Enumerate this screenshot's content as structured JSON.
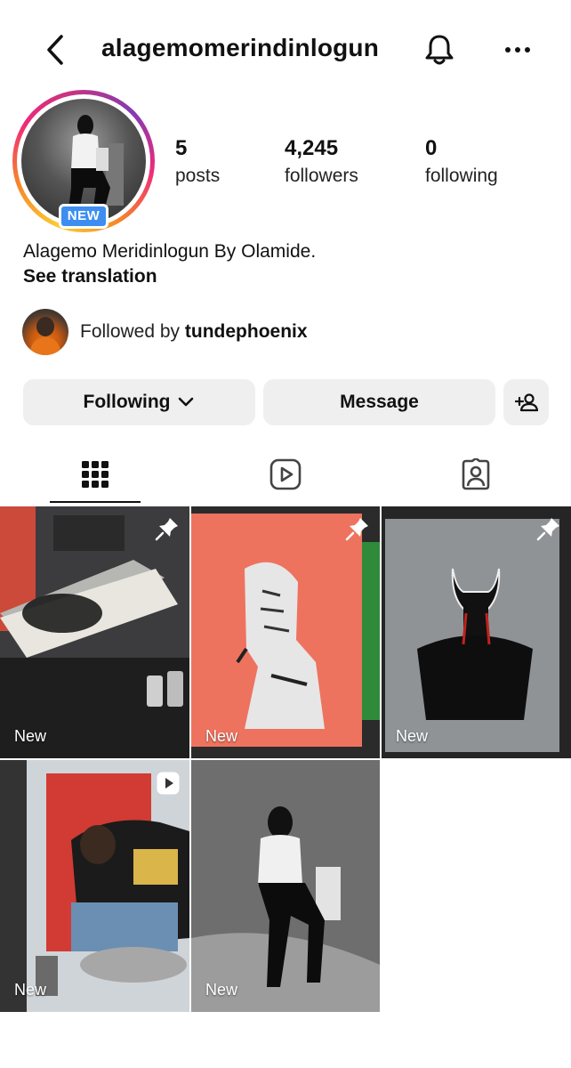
{
  "header": {
    "username": "alagemomerindinlogun"
  },
  "profile": {
    "badge": "NEW",
    "stats": [
      {
        "value": "5",
        "label": "posts"
      },
      {
        "value": "4,245",
        "label": "followers"
      },
      {
        "value": "0",
        "label": "following"
      }
    ],
    "bio": "Alagemo Meridinlogun By Olamide.",
    "see_translation": "See translation",
    "followed_by_prefix": "Followed by",
    "followed_by_user": "tundephoenix"
  },
  "actions": {
    "following": "Following",
    "message": "Message"
  },
  "grid": {
    "tiles": [
      {
        "label": "New",
        "badge": "pin"
      },
      {
        "label": "New",
        "badge": "pin"
      },
      {
        "label": "New",
        "badge": "pin"
      },
      {
        "label": "New",
        "badge": "reel"
      },
      {
        "label": "New",
        "badge": "none"
      }
    ]
  },
  "colors": {
    "badge_blue": "#3d8ef0",
    "button_bg": "#efefef",
    "text": "#111111"
  }
}
